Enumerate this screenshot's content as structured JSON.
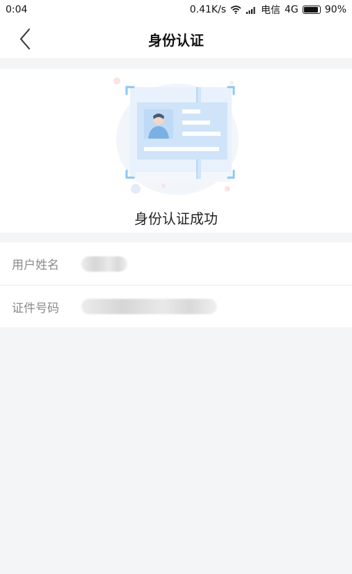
{
  "status_bar": {
    "time": "0:04",
    "speed": "0.41K/s",
    "carrier": "电信",
    "network": "4G",
    "battery": "90%",
    "icons": [
      "wifi-icon",
      "signal-icon",
      "battery-icon"
    ]
  },
  "nav": {
    "title": "身份认证",
    "back_icon": "chevron-left-icon"
  },
  "hero": {
    "illustration": "id-card-illustration",
    "status_text": "身份认证成功"
  },
  "info": {
    "rows": [
      {
        "label": "用户姓名",
        "value_redacted": true
      },
      {
        "label": "证件号码",
        "value_redacted": true
      }
    ]
  },
  "colors": {
    "background": "#f4f5f7",
    "card": "#ffffff",
    "accent_blue": "#9fc9f2",
    "label_gray": "#8a8a8a"
  }
}
